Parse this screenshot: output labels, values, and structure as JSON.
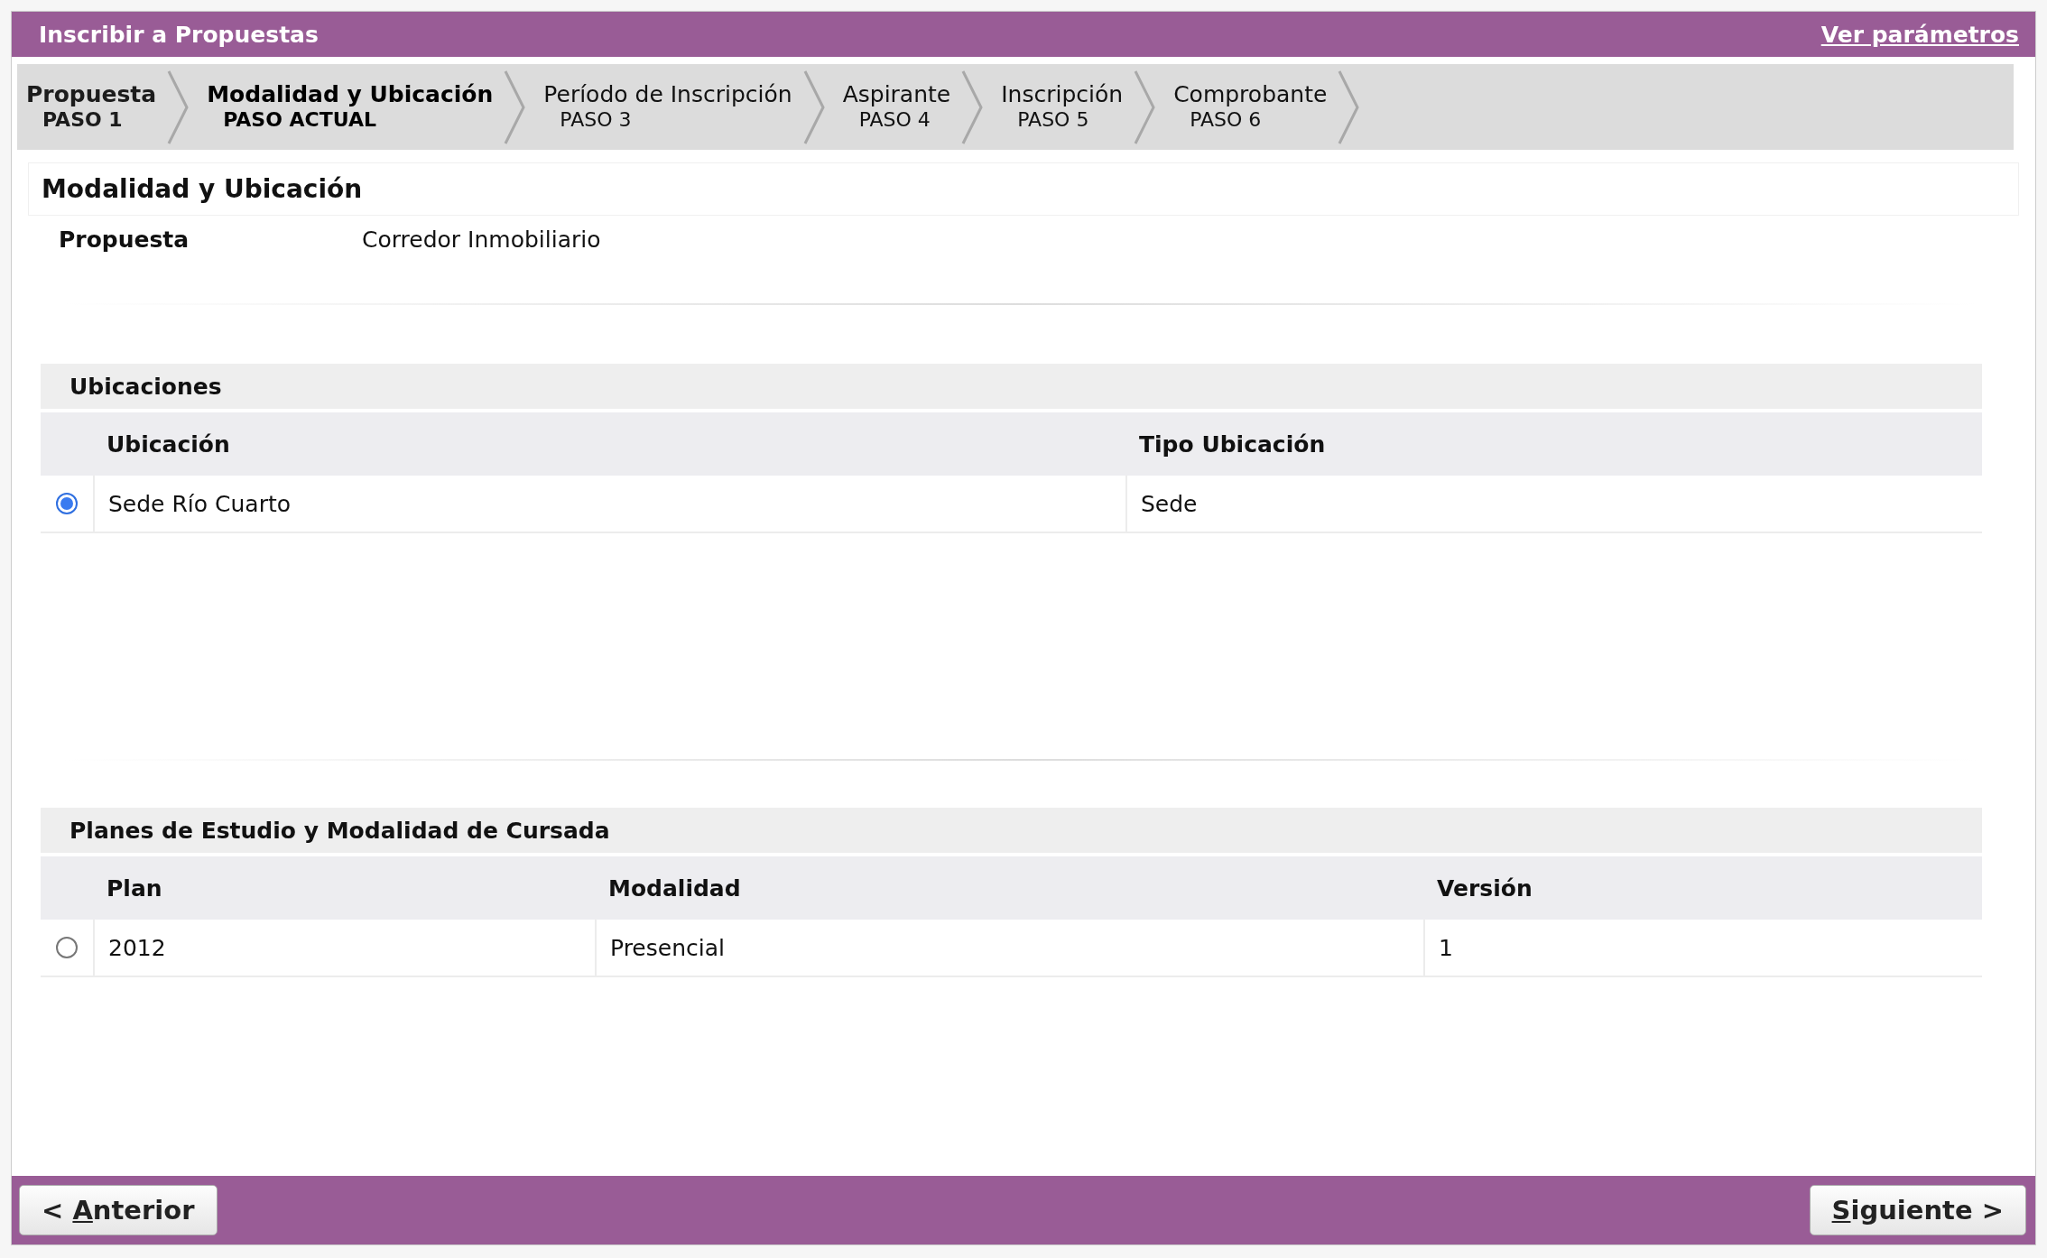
{
  "header": {
    "title": "Inscribir a Propuestas",
    "link": "Ver parámetros"
  },
  "steps": [
    {
      "name": "Propuesta",
      "step": "PASO 1",
      "selected": false,
      "done": true
    },
    {
      "name": "Modalidad y Ubicación",
      "step": "PASO ACTUAL",
      "selected": true,
      "done": false
    },
    {
      "name": "Período de Inscripción",
      "step": "PASO 3",
      "selected": false,
      "done": false
    },
    {
      "name": "Aspirante",
      "step": "PASO 4",
      "selected": false,
      "done": false
    },
    {
      "name": "Inscripción",
      "step": "PASO 5",
      "selected": false,
      "done": false
    },
    {
      "name": "Comprobante",
      "step": "PASO 6",
      "selected": false,
      "done": false
    }
  ],
  "section_title": "Modalidad y Ubicación",
  "summary": {
    "label": "Propuesta",
    "value": "Corredor Inmobiliario"
  },
  "tables": [
    {
      "title": "Ubicaciones",
      "columns": [
        "Ubicación",
        "Tipo Ubicación"
      ],
      "rows": [
        {
          "selected": true,
          "cells": [
            "Sede Río Cuarto",
            "Sede"
          ]
        }
      ]
    },
    {
      "title": "Planes de Estudio y Modalidad de Cursada",
      "columns": [
        "Plan",
        "Modalidad",
        "Versión"
      ],
      "rows": [
        {
          "selected": false,
          "cells": [
            "2012",
            "Presencial",
            "1"
          ]
        }
      ]
    }
  ],
  "footer": {
    "back": {
      "prefix": "< ",
      "key": "A",
      "rest": "nterior"
    },
    "next": {
      "key": "S",
      "rest": "iguiente >"
    }
  }
}
